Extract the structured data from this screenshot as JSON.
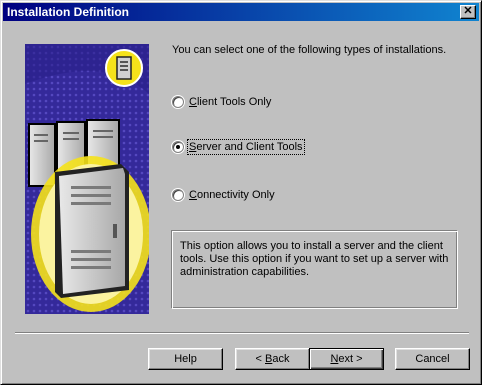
{
  "window": {
    "title": "Installation Definition",
    "close_glyph": "✕"
  },
  "intro_text": "You can select one of the following types of installations.",
  "options": [
    {
      "label": "Client Tools Only",
      "accel": "C",
      "rest": "lient Tools Only",
      "selected": false
    },
    {
      "label": "Server and Client Tools",
      "accel": "S",
      "rest": "erver and Client Tools",
      "selected": true
    },
    {
      "label": "Connectivity Only",
      "accel": "C",
      "rest": "onnectivity Only",
      "selected": false
    }
  ],
  "description": "This option allows you to install a server and the client tools. Use this option if you want to set up a server with administration capabilities.",
  "buttons": {
    "help": "Help",
    "back_prefix": "< ",
    "back_accel": "B",
    "back_rest": "ack",
    "next_accel": "N",
    "next_suffix": "ext >",
    "cancel": "Cancel"
  },
  "icons": {
    "illustration": "server-computers-illustration",
    "badge": "server-badge-icon"
  },
  "colors": {
    "titlebar_start": "#000080",
    "titlebar_end": "#1084d0",
    "illustration_bg": "#3a2fa0",
    "glow": "#f5e21a"
  }
}
